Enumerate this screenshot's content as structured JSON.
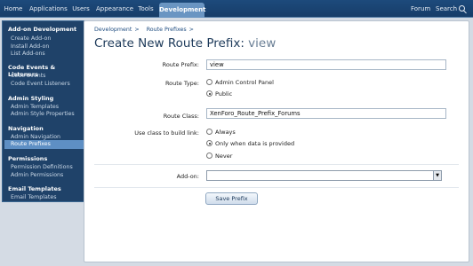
{
  "nav": {
    "tabs": [
      "Home",
      "Applications",
      "Users",
      "Appearance",
      "Tools",
      "Development"
    ],
    "active_tab": "Development",
    "forum_label": "Forum",
    "search_label": "Search"
  },
  "sidebar": {
    "sections": [
      {
        "title": "Add-on Development",
        "items": [
          "Create Add-on",
          "Install Add-on",
          "List Add-ons"
        ]
      },
      {
        "title": "Code Events & Listeners",
        "items": [
          "Code Events",
          "Code Event Listeners"
        ]
      },
      {
        "title": "Admin Styling",
        "items": [
          "Admin Templates",
          "Admin Style Properties"
        ]
      },
      {
        "title": "Navigation",
        "items": [
          "Admin Navigation",
          "Route Prefixes"
        ]
      },
      {
        "title": "Permissions",
        "items": [
          "Permission Definitions",
          "Admin Permissions"
        ]
      },
      {
        "title": "Email Templates",
        "items": [
          "Email Templates"
        ]
      }
    ],
    "active_item": "Route Prefixes"
  },
  "breadcrumb": [
    "Development",
    ">",
    "Route Prefixes",
    ">"
  ],
  "page": {
    "title": "Create New Route Prefix:",
    "title_value": "view"
  },
  "form": {
    "route_prefix_label": "Route Prefix:",
    "route_prefix_value": "view",
    "route_type_label": "Route Type:",
    "route_type_options": [
      "Admin Control Panel",
      "Public"
    ],
    "route_type_selected": "Public",
    "route_class_label": "Route Class:",
    "route_class_value": "XenForo_Route_Prefix_Forums",
    "use_class_label": "Use class to build link:",
    "use_class_options": [
      "Always",
      "Only when data is provided",
      "Never"
    ],
    "use_class_selected": "Only when data is provided",
    "addon_label": "Add-on:",
    "addon_value": "",
    "save_label": "Save Prefix"
  }
}
